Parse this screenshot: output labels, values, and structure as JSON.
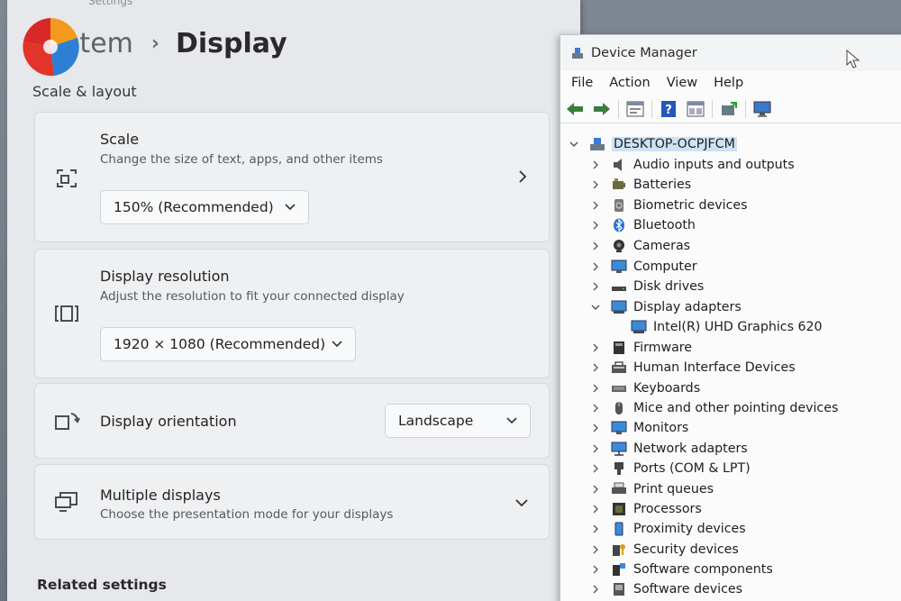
{
  "settings": {
    "titlebar_remnant": "Settings",
    "breadcrumb": {
      "parent": "System",
      "separator": "›",
      "current": "Display"
    },
    "section_title": "Scale & layout",
    "scale": {
      "title": "Scale",
      "description": "Change the size of text, apps, and other items",
      "value": "150% (Recommended)"
    },
    "resolution": {
      "title": "Display resolution",
      "description": "Adjust the resolution to fit your connected display",
      "value": "1920 × 1080 (Recommended)"
    },
    "orientation": {
      "title": "Display orientation",
      "value": "Landscape"
    },
    "multiple": {
      "title": "Multiple displays",
      "description": "Choose the presentation mode for your displays"
    },
    "related_settings": "Related settings"
  },
  "device_manager": {
    "title": "Device Manager",
    "menu": [
      "File",
      "Action",
      "View",
      "Help"
    ],
    "toolbar": [
      "back-icon",
      "forward-icon",
      "properties-icon",
      "help-icon",
      "view-icon",
      "update-driver-icon",
      "scan-hardware-icon"
    ],
    "root": "DESKTOP-OCPJFCM",
    "categories": [
      {
        "label": "Audio inputs and outputs",
        "icon": "speaker-icon"
      },
      {
        "label": "Batteries",
        "icon": "battery-icon"
      },
      {
        "label": "Biometric devices",
        "icon": "fingerprint-icon"
      },
      {
        "label": "Bluetooth",
        "icon": "bluetooth-icon"
      },
      {
        "label": "Cameras",
        "icon": "camera-icon"
      },
      {
        "label": "Computer",
        "icon": "computer-icon"
      },
      {
        "label": "Disk drives",
        "icon": "disk-icon"
      },
      {
        "label": "Display adapters",
        "icon": "display-adapter-icon",
        "expanded": true,
        "children": [
          "Intel(R) UHD Graphics 620"
        ]
      },
      {
        "label": "Firmware",
        "icon": "firmware-icon"
      },
      {
        "label": "Human Interface Devices",
        "icon": "hid-icon"
      },
      {
        "label": "Keyboards",
        "icon": "keyboard-icon"
      },
      {
        "label": "Mice and other pointing devices",
        "icon": "mouse-icon"
      },
      {
        "label": "Monitors",
        "icon": "monitor-icon"
      },
      {
        "label": "Network adapters",
        "icon": "network-icon"
      },
      {
        "label": "Ports (COM & LPT)",
        "icon": "port-icon"
      },
      {
        "label": "Print queues",
        "icon": "printer-icon"
      },
      {
        "label": "Processors",
        "icon": "processor-icon"
      },
      {
        "label": "Proximity devices",
        "icon": "proximity-icon"
      },
      {
        "label": "Security devices",
        "icon": "security-icon"
      },
      {
        "label": "Software components",
        "icon": "software-component-icon"
      },
      {
        "label": "Software devices",
        "icon": "software-device-icon"
      }
    ]
  },
  "colors": {
    "accent_blue": "#1f6fd0",
    "selection_bg": "#cde3f5",
    "logo_red": "#e2342b",
    "logo_blue": "#2d7fd3",
    "logo_orange": "#f39a1d"
  }
}
